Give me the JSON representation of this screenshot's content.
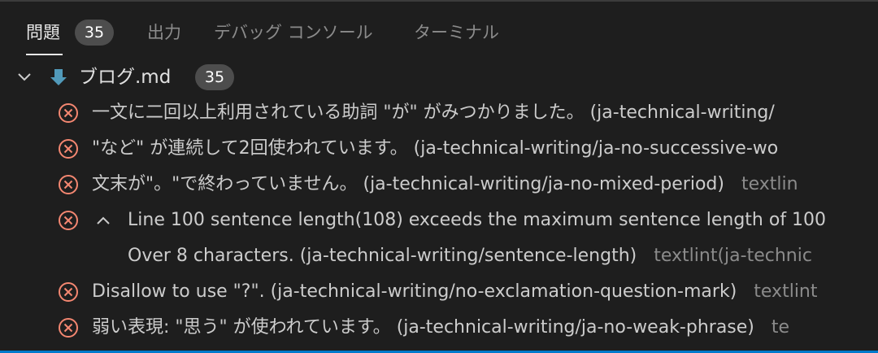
{
  "tabs": [
    {
      "label": "問題",
      "badge": "35"
    },
    {
      "label": "出力"
    },
    {
      "label": "デバッグ コンソール"
    },
    {
      "label": "ターミナル"
    }
  ],
  "file_group": {
    "name": "ブログ.md",
    "count": "35"
  },
  "problems": [
    {
      "message": "一文に二回以上利用されている助詞 \"が\" がみつかりました。",
      "source": "(ja-technical-writing/",
      "owner": ""
    },
    {
      "message": "\"など\" が連続して2回使われています。",
      "source": "(ja-technical-writing/ja-no-successive-wo",
      "owner": ""
    },
    {
      "message": "文末が\"。\"で終わっていません。",
      "source": "(ja-technical-writing/ja-no-mixed-period)",
      "owner": "textlin"
    },
    {
      "message": "Line 100 sentence length(108) exceeds the maximum sentence length of 100",
      "source": "",
      "owner": ""
    },
    {
      "message": "Over 8 characters.",
      "source": "(ja-technical-writing/sentence-length)",
      "owner": "textlint(ja-technic"
    },
    {
      "message": "Disallow to use \"?\".",
      "source": "(ja-technical-writing/no-exclamation-question-mark)",
      "owner": "textlint"
    },
    {
      "message": "弱い表現: \"思う\" が使われています。",
      "source": "(ja-technical-writing/ja-no-weak-phrase)",
      "owner": "te"
    }
  ],
  "colors": {
    "background": "#1e1e1e",
    "error": "#f48771",
    "markdown_icon": "#519aba",
    "badge": "#4d4d4d",
    "status_bar": "#007acc"
  },
  "icons": {
    "error": "error-circle-x-icon",
    "expand": "chevron-down-icon",
    "collapse": "chevron-up-icon",
    "markdown": "markdown-down-arrow-icon"
  }
}
